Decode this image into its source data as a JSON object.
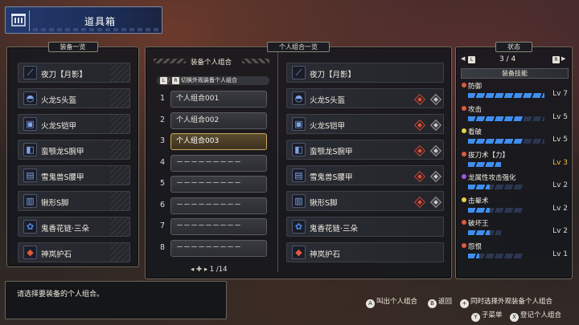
{
  "header": {
    "title": "道具箱",
    "logo_icon": "item-box-icon"
  },
  "left_panel": {
    "title": "装备一览",
    "items": [
      {
        "label": "夜刀【月影】",
        "icon": "long-sword-icon"
      },
      {
        "label": "火龙S头盔",
        "icon": "helmet-icon"
      },
      {
        "label": "火龙S铠甲",
        "icon": "chest-armor-icon"
      },
      {
        "label": "蛮颚龙S腕甲",
        "icon": "arm-armor-icon"
      },
      {
        "label": "雪鬼兽S腰甲",
        "icon": "waist-armor-icon"
      },
      {
        "label": "锹形S脚",
        "icon": "leg-armor-icon"
      },
      {
        "label": "鬼香花链·三朵",
        "icon": "petalace-icon"
      },
      {
        "label": "神岚护石",
        "icon": "talisman-icon"
      }
    ]
  },
  "center_panel": {
    "title": "个人组合一览",
    "subtitle": "装备个人组合",
    "toggle_hint": "切换外观装备个人组合",
    "toggle_keys": [
      "L",
      "R"
    ],
    "sets": [
      {
        "num": "1",
        "label": "个人组合001",
        "selected": false
      },
      {
        "num": "2",
        "label": "个人组合002",
        "selected": false
      },
      {
        "num": "3",
        "label": "个人组合003",
        "selected": true
      },
      {
        "num": "4",
        "label": "－－－－－－－－－",
        "selected": false
      },
      {
        "num": "5",
        "label": "－－－－－－－－－",
        "selected": false
      },
      {
        "num": "6",
        "label": "－－－－－－－－－",
        "selected": false
      },
      {
        "num": "7",
        "label": "－－－－－－－－－",
        "selected": false
      },
      {
        "num": "8",
        "label": "－－－－－－－－－",
        "selected": false
      }
    ],
    "pager": "1 /14",
    "preview_items": [
      {
        "label": "夜刀【月影】",
        "icon": "long-sword-icon",
        "decos": false
      },
      {
        "label": "火龙S头盔",
        "icon": "helmet-icon",
        "decos": true
      },
      {
        "label": "火龙S铠甲",
        "icon": "chest-armor-icon",
        "decos": true
      },
      {
        "label": "蛮颚龙S腕甲",
        "icon": "arm-armor-icon",
        "decos": true
      },
      {
        "label": "雪鬼兽S腰甲",
        "icon": "waist-armor-icon",
        "decos": true
      },
      {
        "label": "锹形S脚",
        "icon": "leg-armor-icon",
        "decos": true
      },
      {
        "label": "鬼香花链·三朵",
        "icon": "petalace-icon",
        "decos": false
      },
      {
        "label": "神岚护石",
        "icon": "talisman-icon",
        "decos": false
      }
    ]
  },
  "right_panel": {
    "title": "状态",
    "page": "3 / 4",
    "prev_key": "L",
    "next_key": "R",
    "section": "装备技能",
    "skills": [
      {
        "name": "防御",
        "level": "Lv 7",
        "filled": 7,
        "max": 7,
        "color": "#e05a3a",
        "highlight": false
      },
      {
        "name": "攻击",
        "level": "Lv 5",
        "filled": 5,
        "max": 7,
        "color": "#e05a3a",
        "highlight": false
      },
      {
        "name": "看破",
        "level": "Lv 5",
        "filled": 5,
        "max": 7,
        "color": "#e8d24a",
        "highlight": false
      },
      {
        "name": "拔刀术【力】",
        "level": "Lv 3",
        "filled": 3,
        "max": 3,
        "color": "#e05a3a",
        "highlight": true
      },
      {
        "name": "龙属性攻击强化",
        "level": "Lv 2",
        "filled": 2,
        "max": 5,
        "color": "#9c5ae0",
        "highlight": false
      },
      {
        "name": "击晕术",
        "level": "Lv 2",
        "filled": 2,
        "max": 5,
        "color": "#e8d24a",
        "highlight": false
      },
      {
        "name": "破坏王",
        "level": "Lv 2",
        "filled": 2,
        "max": 3,
        "color": "#e05a3a",
        "highlight": false
      },
      {
        "name": "怨恨",
        "level": "Lv 1",
        "filled": 1,
        "max": 5,
        "color": "#e05a3a",
        "highlight": false
      }
    ]
  },
  "message": "请选择要装备的个人组合。",
  "hints": {
    "call_set": {
      "key": "A",
      "label": "叫出个人组合"
    },
    "back": {
      "key": "B",
      "label": "返回"
    },
    "also_layered": {
      "key": "+",
      "label": "同时选择外观装备个人组合"
    },
    "submenu": {
      "key": "Y",
      "label": "子菜单"
    },
    "register": {
      "key": "X",
      "label": "登记个人组合"
    }
  }
}
